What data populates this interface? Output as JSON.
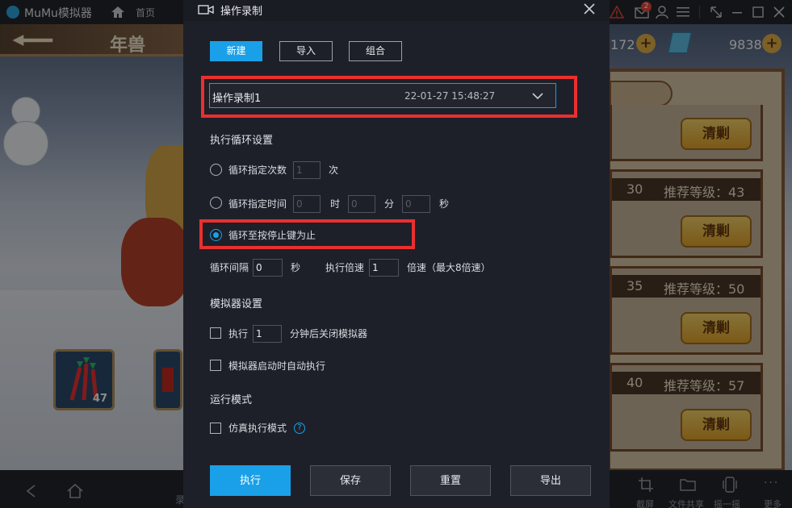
{
  "titlebar": {
    "app_name": "MuMu模拟器",
    "home_label": "首页",
    "notification_count": "2"
  },
  "game": {
    "title": "年兽",
    "currency_left": "172",
    "currency_right": "9838",
    "item_count": "47",
    "clear_label": "清剿",
    "levels": [
      {
        "num": "30",
        "label": "推荐等级：43"
      },
      {
        "num": "35",
        "label": "推荐等级：50"
      },
      {
        "num": "40",
        "label": "推荐等级：57"
      }
    ]
  },
  "bottombar": {
    "screenshot_label": "截屏",
    "file_share_label": "文件共享",
    "shake_label": "摇一摇",
    "more_label": "更多",
    "record_label": "录"
  },
  "dialog": {
    "title": "操作录制",
    "tabs": {
      "new": "新建",
      "import": "导入",
      "combine": "组合"
    },
    "recording": {
      "name": "操作录制1",
      "date": "22-01-27 15:48:27"
    },
    "loop_section": "执行循环设置",
    "loop_count_label": "循环指定次数",
    "loop_count_value": "1",
    "loop_count_unit": "次",
    "loop_time_label": "循环指定时间",
    "loop_time_hours": "0",
    "loop_time_hours_unit": "时",
    "loop_time_minutes": "0",
    "loop_time_minutes_unit": "分",
    "loop_time_seconds": "0",
    "loop_time_seconds_unit": "秒",
    "loop_until_stop_label": "循环至按停止键为止",
    "interval_label": "循环间隔",
    "interval_value": "0",
    "interval_unit": "秒",
    "speed_label": "执行倍速",
    "speed_value": "1",
    "speed_unit": "倍速（最大8倍速）",
    "emulator_section": "模拟器设置",
    "exec_label": "执行",
    "exec_minutes_value": "1",
    "exec_suffix": "分钟后关闭模拟器",
    "autostart_label": "模拟器启动时自动执行",
    "run_mode_section": "运行模式",
    "sim_mode_label": "仿真执行模式",
    "help_symbol": "?",
    "actions": {
      "execute": "执行",
      "save": "保存",
      "reset": "重置",
      "export": "导出"
    },
    "colors": {
      "accent": "#1aa0e8",
      "highlight": "#ea2f2f"
    }
  }
}
